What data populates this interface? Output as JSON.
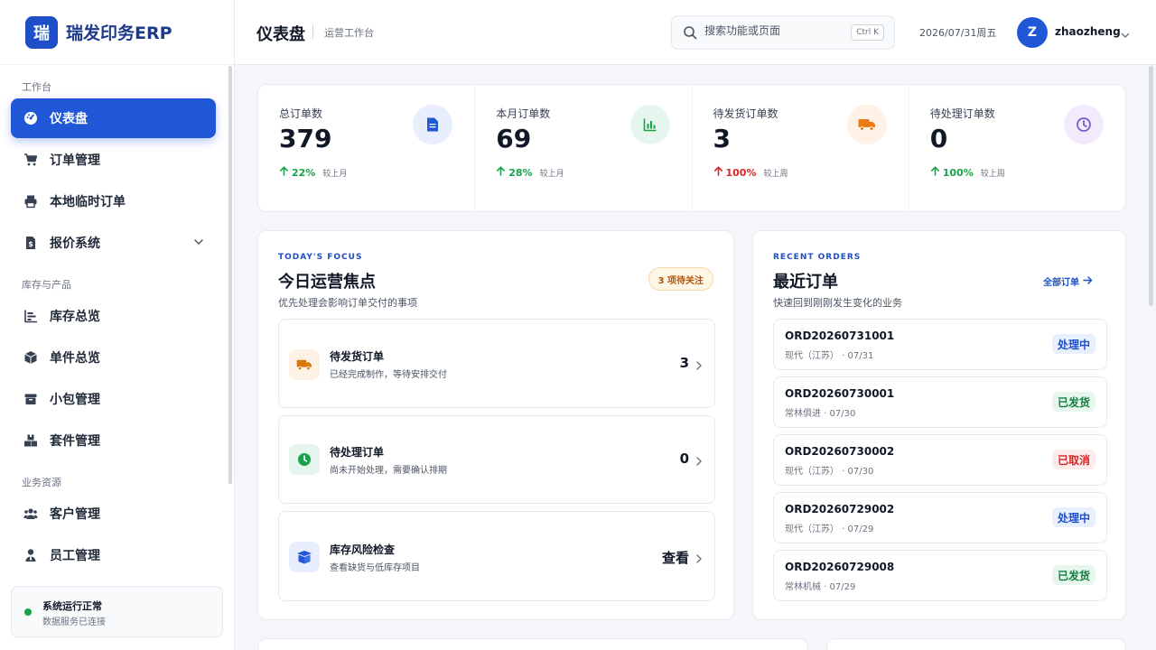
{
  "brand": {
    "logo_char": "瑞",
    "name": "瑞发印务ERP"
  },
  "sidebar": {
    "sections": [
      "工作台",
      "库存与产品",
      "业务资源"
    ],
    "items": [
      {
        "label": "仪表盘",
        "icon": "dashboard-gauge-icon",
        "active": true
      },
      {
        "label": "订单管理",
        "icon": "cart-icon"
      },
      {
        "label": "本地临时订单",
        "icon": "printer-icon"
      },
      {
        "label": "报价系统",
        "icon": "price-document-icon"
      },
      {
        "label": "库存总览",
        "icon": "bar-chart-icon"
      },
      {
        "label": "单件总览",
        "icon": "box-icon"
      },
      {
        "label": "小包管理",
        "icon": "package-icon"
      },
      {
        "label": "套件管理",
        "icon": "boxes-icon"
      },
      {
        "label": "客户管理",
        "icon": "users-icon"
      },
      {
        "label": "员工管理",
        "icon": "user-tie-icon"
      }
    ],
    "status": {
      "title": "系统运行正常",
      "subtitle": "数据服务已连接",
      "color": "#16a34a"
    }
  },
  "header": {
    "title": "仪表盘",
    "subtitle": "运营工作台",
    "search_placeholder": "搜索功能或页面",
    "shortcut": "Ctrl K",
    "date": "2026/07/31周五",
    "avatar_initial": "Z",
    "username": "zhaozheng"
  },
  "stats": [
    {
      "label": "总订单数",
      "value": "379",
      "change": "22%",
      "compare": "较上月",
      "trend": "up",
      "trend_color": "#16a34a",
      "icon": "document-icon",
      "icon_bg": "#e8eefd",
      "icon_color": "#2057d6"
    },
    {
      "label": "本月订单数",
      "value": "69",
      "change": "28%",
      "compare": "较上月",
      "trend": "up",
      "trend_color": "#16a34a",
      "icon": "chart-icon",
      "icon_bg": "#e6f6ee",
      "icon_color": "#16a34a"
    },
    {
      "label": "待发货订单数",
      "value": "3",
      "change": "100%",
      "compare": "较上周",
      "trend": "up",
      "trend_color": "#dc2626",
      "icon": "truck-icon",
      "icon_bg": "#fef1e6",
      "icon_color": "#ea7a14"
    },
    {
      "label": "待处理订单数",
      "value": "0",
      "change": "100%",
      "compare": "较上周",
      "trend": "up",
      "trend_color": "#16a34a",
      "icon": "clock-icon",
      "icon_bg": "#f1ebfd",
      "icon_color": "#7c5ac9"
    }
  ],
  "focus": {
    "eyebrow": "TODAY'S FOCUS",
    "title": "今日运营焦点",
    "subtitle": "优先处理会影响订单交付的事项",
    "pill": "3 项待关注",
    "items": [
      {
        "title": "待发货订单",
        "desc": "已经完成制作，等待安排交付",
        "value": "3",
        "icon": "truck-icon"
      },
      {
        "title": "待处理订单",
        "desc": "尚未开始处理，需要确认排期",
        "value": "0",
        "icon": "clock-icon"
      },
      {
        "title": "库存风险检查",
        "desc": "查看缺货与低库存项目",
        "value": "查看",
        "icon": "box-open-icon"
      }
    ]
  },
  "recent": {
    "eyebrow": "RECENT ORDERS",
    "title": "最近订单",
    "subtitle": "快速回到刚刚发生变化的业务",
    "all_link": "全部订单",
    "orders": [
      {
        "id": "ORD20260731001",
        "meta": "现代（江苏） · 07/31",
        "status": "处理中",
        "kind": "blue"
      },
      {
        "id": "ORD20260730001",
        "meta": "常林俱进 · 07/30",
        "status": "已发货",
        "kind": "green"
      },
      {
        "id": "ORD20260730002",
        "meta": "现代（江苏） · 07/30",
        "status": "已取消",
        "kind": "red"
      },
      {
        "id": "ORD20260729002",
        "meta": "现代（江苏） · 07/29",
        "status": "处理中",
        "kind": "blue"
      },
      {
        "id": "ORD20260729008",
        "meta": "常林机械 · 07/29",
        "status": "已发货",
        "kind": "green"
      }
    ]
  }
}
